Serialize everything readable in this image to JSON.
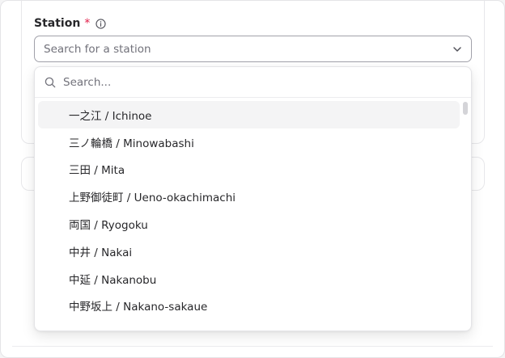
{
  "field": {
    "label": "Station",
    "required_mark": "*",
    "placeholder": "Search for a station"
  },
  "dropdown": {
    "search_placeholder": "Search...",
    "options": [
      "一之江 / Ichinoe",
      "三ノ輪橋 / Minowabashi",
      "三田 / Mita",
      "上野御徒町 / Ueno-okachimachi",
      "両国 / Ryogoku",
      "中井 / Nakai",
      "中延 / Nakanobu",
      "中野坂上 / Nakano-sakaue"
    ],
    "highlighted_index": 0
  },
  "icons": {
    "info": "info-icon",
    "chevron": "chevron-down-icon",
    "search": "search-icon"
  },
  "colors": {
    "required": "#e11d48",
    "highlight": "#f4f4f5"
  }
}
